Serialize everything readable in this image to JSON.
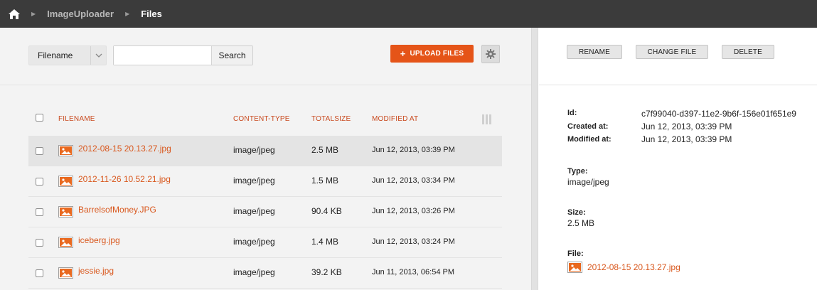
{
  "breadcrumb": {
    "items": [
      {
        "label": "ImageUploader"
      },
      {
        "label": "Files"
      }
    ]
  },
  "toolbar": {
    "filter_select": "Filename",
    "search_placeholder": "",
    "search_button": "Search",
    "upload_button": "UPLOAD FILES"
  },
  "table": {
    "headers": {
      "filename": "FILENAME",
      "content_type": "CONTENT-TYPE",
      "total_size": "TOTALSIZE",
      "modified_at": "MODIFIED AT"
    },
    "rows": [
      {
        "filename": "2012-08-15 20.13.27.jpg",
        "content_type": "image/jpeg",
        "size": "2.5 MB",
        "modified": "Jun 12, 2013, 03:39 PM",
        "selected": true
      },
      {
        "filename": "2012-11-26 10.52.21.jpg",
        "content_type": "image/jpeg",
        "size": "1.5 MB",
        "modified": "Jun 12, 2013, 03:34 PM",
        "selected": false
      },
      {
        "filename": "BarrelsofMoney.JPG",
        "content_type": "image/jpeg",
        "size": "90.4 KB",
        "modified": "Jun 12, 2013, 03:26 PM",
        "selected": false
      },
      {
        "filename": "iceberg.jpg",
        "content_type": "image/jpeg",
        "size": "1.4 MB",
        "modified": "Jun 12, 2013, 03:24 PM",
        "selected": false
      },
      {
        "filename": "jessie.jpg",
        "content_type": "image/jpeg",
        "size": "39.2 KB",
        "modified": "Jun 11, 2013, 06:54 PM",
        "selected": false
      }
    ]
  },
  "details": {
    "actions": {
      "rename": "RENAME",
      "change_file": "CHANGE FILE",
      "delete": "DELETE"
    },
    "id_label": "Id:",
    "id_value": "c7f99040-d397-11e2-9b6f-156e01f651e9",
    "created_label": "Created at:",
    "created_value": "Jun 12, 2013, 03:39 PM",
    "modified_label": "Modified at:",
    "modified_value": "Jun 12, 2013, 03:39 PM",
    "type_label": "Type:",
    "type_value": "image/jpeg",
    "size_label": "Size:",
    "size_value": "2.5 MB",
    "file_label": "File:",
    "file_value": "2012-08-15 20.13.27.jpg"
  },
  "colors": {
    "accent": "#e55418",
    "link": "#d9581e",
    "header_text": "#c94a1f",
    "topbar": "#3b3b3b"
  },
  "icons": [
    "home-icon",
    "chevron-right-icon",
    "chevron-down-icon",
    "plus-icon",
    "gear-icon",
    "columns-icon",
    "image-file-icon"
  ]
}
